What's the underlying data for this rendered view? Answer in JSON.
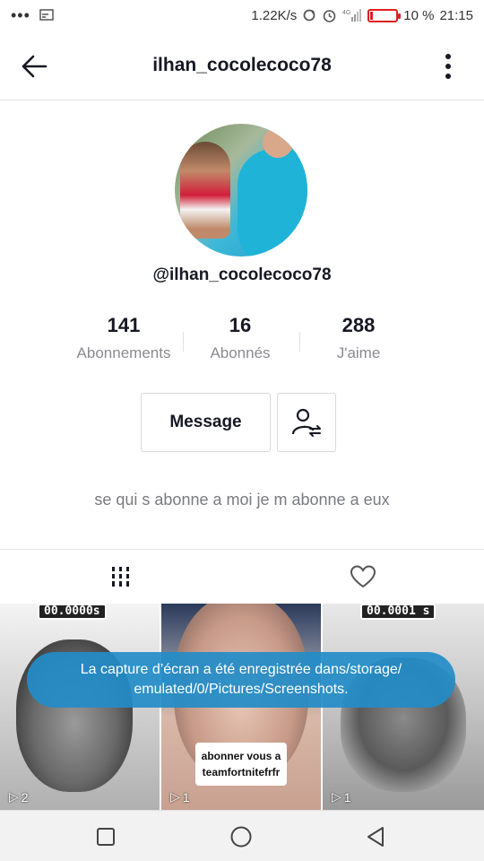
{
  "status_bar": {
    "left_icons": [
      "more-dots-icon",
      "cast-icon"
    ],
    "network_speed": "1.22K/s",
    "right_icons": [
      "sync-icon",
      "alarm-icon",
      "signal-icon",
      "battery-icon"
    ],
    "battery_level": 0.1,
    "battery_text": "10 %",
    "time": "21:15",
    "battery_color": "#e02020"
  },
  "header": {
    "title": "ilhan_cocolecoco78",
    "back_icon": "arrow-left-icon",
    "more_icon": "vertical-dots-icon"
  },
  "profile": {
    "handle": "@ilhan_cocolecoco78",
    "stats": [
      {
        "value": "141",
        "label": "Abonnements"
      },
      {
        "value": "16",
        "label": "Abonnés"
      },
      {
        "value": "288",
        "label": "J'aime"
      }
    ],
    "message_label": "Message",
    "follow_icon": "user-swap-icon",
    "bio": "se qui s abonne a moi je m abonne a eux"
  },
  "tabs": [
    {
      "icon": "grid-icon",
      "active": true
    },
    {
      "icon": "heart-icon",
      "active": false
    }
  ],
  "videos": [
    {
      "timer": "00.0000s",
      "plays": "2"
    },
    {
      "plays": "1",
      "caption_line1": "abonner vous a",
      "caption_line2": "teamfortnitefrfr"
    },
    {
      "timer": "00.0001 s",
      "plays": "1"
    }
  ],
  "toast": {
    "line1": "La capture d’écran a été enregistrée dans/storage/",
    "line2": "emulated/0/Pictures/Screenshots."
  },
  "navbar": {
    "icons": [
      "square-icon",
      "circle-icon",
      "triangle-back-icon"
    ]
  }
}
